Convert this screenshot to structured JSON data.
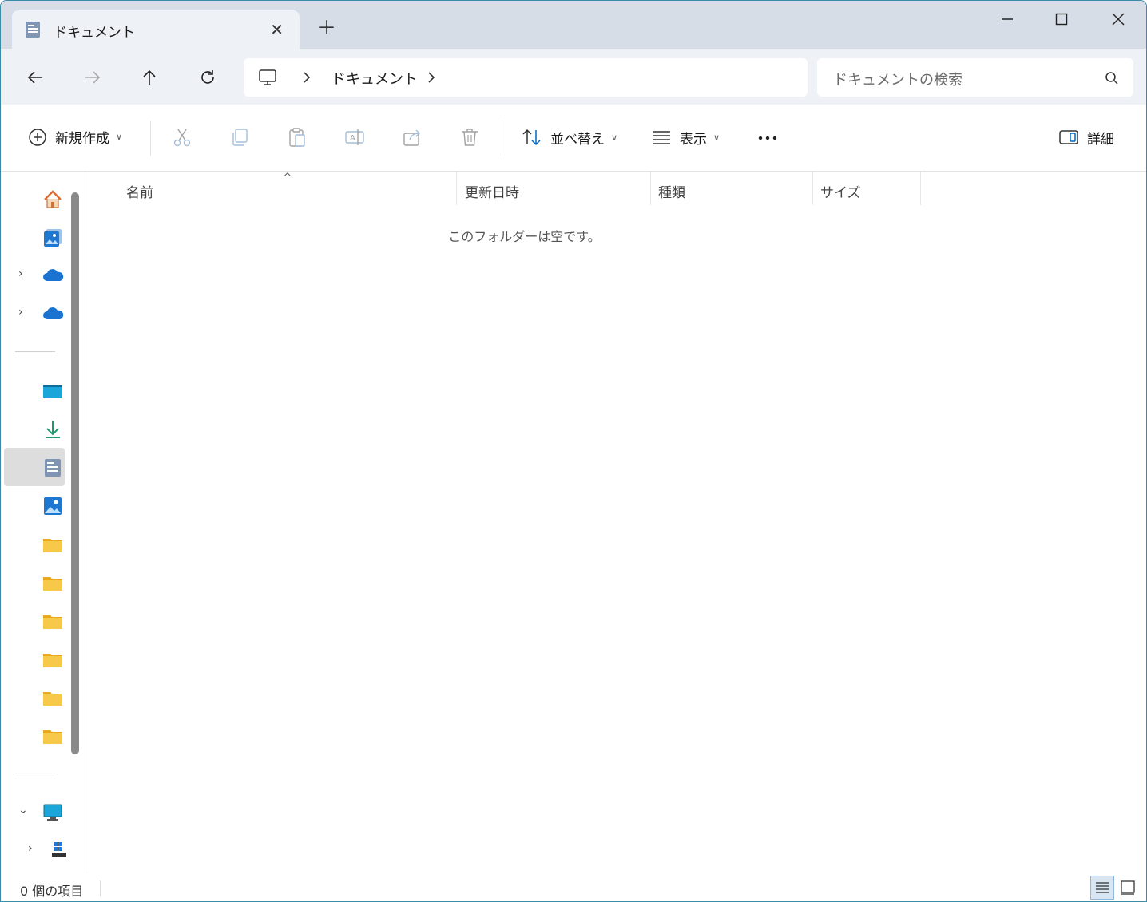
{
  "tab": {
    "title": "ドキュメント"
  },
  "address": {
    "crumb": "ドキュメント"
  },
  "search": {
    "placeholder": "ドキュメントの検索"
  },
  "toolbar": {
    "new_label": "新規作成",
    "sort_label": "並べ替え",
    "view_label": "表示",
    "details_label": "詳細"
  },
  "columns": {
    "name": "名前",
    "modified": "更新日時",
    "type": "種類",
    "size": "サイズ"
  },
  "content": {
    "empty_message": "このフォルダーは空です。"
  },
  "status": {
    "item_count": "0 個の項目"
  },
  "colors": {
    "accent": "#0067c0",
    "folder": "#f7c948",
    "onedrive": "#1a73d1"
  }
}
